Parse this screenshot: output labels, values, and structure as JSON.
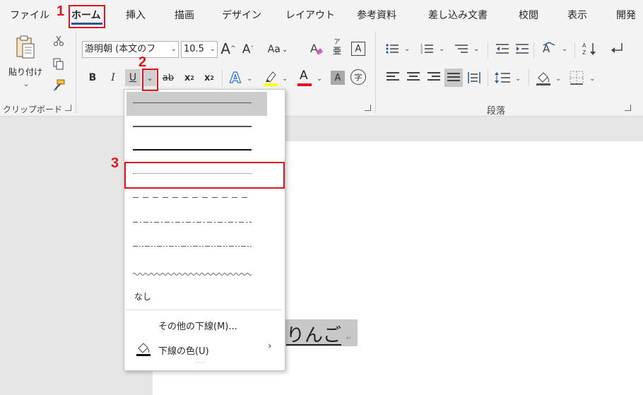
{
  "menu": {
    "tabs": [
      "ファイル",
      "ホーム",
      "挿入",
      "描画",
      "デザイン",
      "レイアウト",
      "参考資料",
      "差し込み文書",
      "校閲",
      "表示",
      "開発"
    ]
  },
  "ribbon": {
    "clipboard": {
      "paste_label": "貼り付け",
      "group_label": "クリップボード"
    },
    "font": {
      "font_name": "游明朝 (本文のフ",
      "font_size": "10.5",
      "grow": "A",
      "shrink": "A",
      "change_case": "Aa",
      "phonetic_top": "ア",
      "phonetic_bottom": "亜",
      "border_char": "A",
      "bold": "B",
      "italic": "I",
      "underline": "U",
      "strike": "ab",
      "subscript": "x",
      "subscript_mark": "2",
      "superscript": "x",
      "superscript_mark": "2",
      "text_effect": "A",
      "font_color": "A",
      "shading": "A",
      "enclose": "字"
    },
    "paragraph": {
      "group_label": "段落"
    }
  },
  "dropdown": {
    "more_underlines": "その他の下線(M)...",
    "underline_color": "下線の色(U)",
    "none_label": "なし"
  },
  "document": {
    "text": "りんご"
  },
  "annotations": [
    "1",
    "2",
    "3"
  ],
  "colors": {
    "accent_blue": "#2b579a",
    "annotation_red": "#e0141e",
    "highlight_yellow": "#ffff00",
    "font_color_red": "#e81123"
  }
}
